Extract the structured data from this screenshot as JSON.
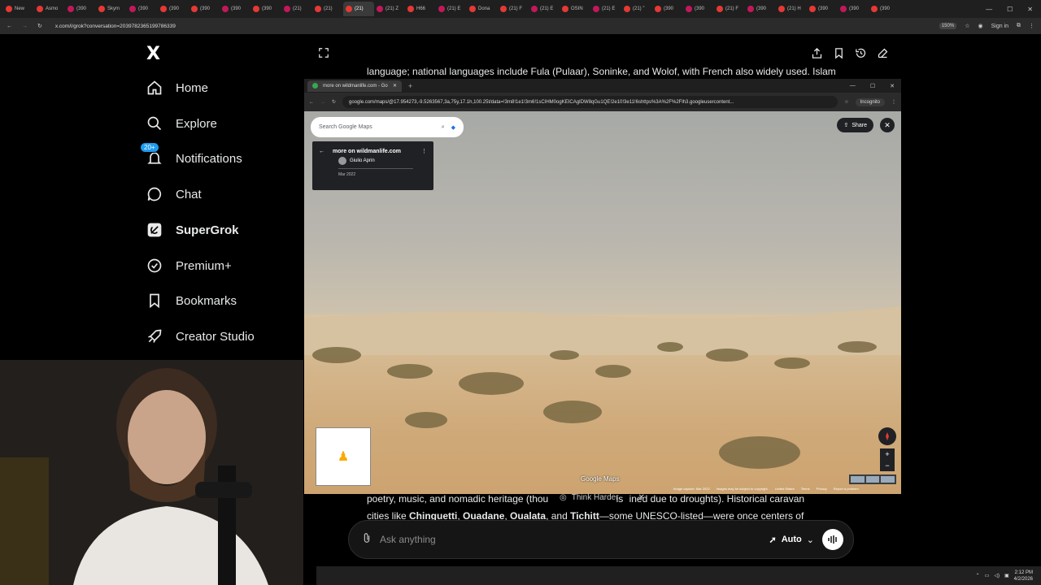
{
  "browser": {
    "tabs": [
      "New",
      "Asmo",
      "(390",
      "Skym",
      "(390",
      "(390",
      "(390",
      "(390",
      "(390",
      "(21)",
      "(21)",
      "(21)",
      "(21) Z",
      "H66",
      "(21) E",
      "Dona",
      "(21) F",
      "(21) E",
      "OSIN",
      "(21) E",
      "(21) \"",
      "(390",
      "(390",
      "(21) F",
      "(390",
      "(21) H",
      "(390",
      "(390",
      "(390"
    ],
    "url": "x.com/i/grok?conversation=2039782365199786339",
    "zoom": "150%",
    "sign_in": "Sign in"
  },
  "sidebar": {
    "logo": "X",
    "items": [
      {
        "label": "Home",
        "icon": "home-icon"
      },
      {
        "label": "Explore",
        "icon": "search-icon"
      },
      {
        "label": "Notifications",
        "icon": "bell-icon",
        "badge": "20+"
      },
      {
        "label": "Chat",
        "icon": "chat-icon"
      },
      {
        "label": "SuperGrok",
        "icon": "grok-icon"
      },
      {
        "label": "Premium+",
        "icon": "verified-icon"
      },
      {
        "label": "Bookmarks",
        "icon": "bookmark-icon"
      },
      {
        "label": "Creator Studio",
        "icon": "rocket-icon"
      }
    ]
  },
  "conversation": {
    "line_top": "language; national languages include Fula (Pulaar), Soninke, and Wolof, with French also widely used. Islam",
    "line_bottom_1": "poetry, music, and nomadic heritage (thou",
    "line_bottom_1b": "is",
    "line_bottom_1c": "ined due to droughts). Historical caravan",
    "line_bottom_2_pre": "cities like ",
    "city_1": "Chinguetti",
    "city_2": "Ouadane",
    "city_3": "Oualata",
    "city_4": "Tichitt",
    "line_bottom_2_post": "—some UNESCO-listed—were once centers of",
    "sep": ", ",
    "and": ", and "
  },
  "maps_window": {
    "tab_title": "more on wildmanlife.com - Go",
    "url": "google.com/maps/@17.954273,-9.5263567,3a,75y,17.1h,100.25t/data=!3m8!1e1!3m6!1sCIHM0ogKEICAgIDW8qGu1QE!2e10!3e11!6shttps%3A%2F%2Flh3.googleusercontent...",
    "incognito": "Incognito",
    "search_placeholder": "Search Google Maps",
    "card_title": "more on wildmanlife.com",
    "card_author": "Giulio Aprin",
    "card_date": "Mar 2022",
    "share": "Share",
    "logo": "Google Maps",
    "footer": [
      "Image capture: Mar 2022",
      "Images may be subject to copyright.",
      "United States",
      "Terms",
      "Privacy",
      "Report a problem"
    ]
  },
  "think_harder": "Think Harder",
  "input": {
    "placeholder": "Ask anything",
    "mode": "Auto"
  },
  "taskbar": {
    "time": "2:12 PM",
    "date": "4/2/2026"
  }
}
